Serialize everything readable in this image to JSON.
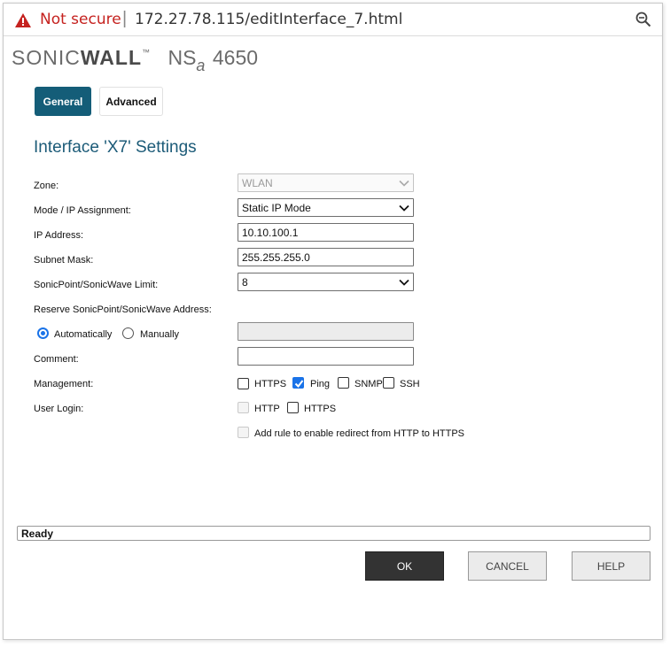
{
  "browser": {
    "security_label": "Not secure",
    "separator": "|",
    "url": "172.27.78.115/editInterface_7.html"
  },
  "brand": {
    "sonic": "SONIC",
    "wall": "WALL",
    "tm": "™",
    "model": "NS",
    "model_sub": "a",
    "model_num": "4650"
  },
  "tabs": [
    {
      "label": "General",
      "active": true
    },
    {
      "label": "Advanced",
      "active": false
    }
  ],
  "section_title": "Interface 'X7' Settings",
  "form": {
    "zone": {
      "label": "Zone:",
      "value": "WLAN",
      "disabled": true
    },
    "mode": {
      "label": "Mode / IP Assignment:",
      "value": "Static IP Mode"
    },
    "ip_address": {
      "label": "IP Address:",
      "value": "10.10.100.1"
    },
    "subnet_mask": {
      "label": "Subnet Mask:",
      "value": "255.255.255.0"
    },
    "limit": {
      "label": "SonicPoint/SonicWave Limit:",
      "value": "8"
    },
    "reserve": {
      "label": "Reserve SonicPoint/SonicWave Address:",
      "option_auto": "Automatically",
      "option_manual": "Manually",
      "selected": "Automatically",
      "value": ""
    },
    "comment": {
      "label": "Comment:",
      "value": ""
    },
    "management": {
      "label": "Management:",
      "options": [
        {
          "label": "HTTPS",
          "checked": false
        },
        {
          "label": "Ping",
          "checked": true
        },
        {
          "label": "SNMP",
          "checked": false
        },
        {
          "label": "SSH",
          "checked": false
        }
      ]
    },
    "user_login": {
      "label": "User Login:",
      "options": [
        {
          "label": "HTTP",
          "checked": false,
          "disabled": true
        },
        {
          "label": "HTTPS",
          "checked": false,
          "disabled": false
        }
      ]
    },
    "redirect": {
      "label": "Add rule to enable redirect from HTTP to HTTPS",
      "checked": false,
      "disabled": true
    }
  },
  "status": "Ready",
  "buttons": {
    "ok": "OK",
    "cancel": "CANCEL",
    "help": "HELP"
  },
  "colors": {
    "brand_blue": "#145d78",
    "warning_red": "#c5221f",
    "check_blue": "#1a73e8"
  },
  "icons": {
    "warning": "warning-triangle-icon",
    "zoom": "zoom-out-icon"
  }
}
